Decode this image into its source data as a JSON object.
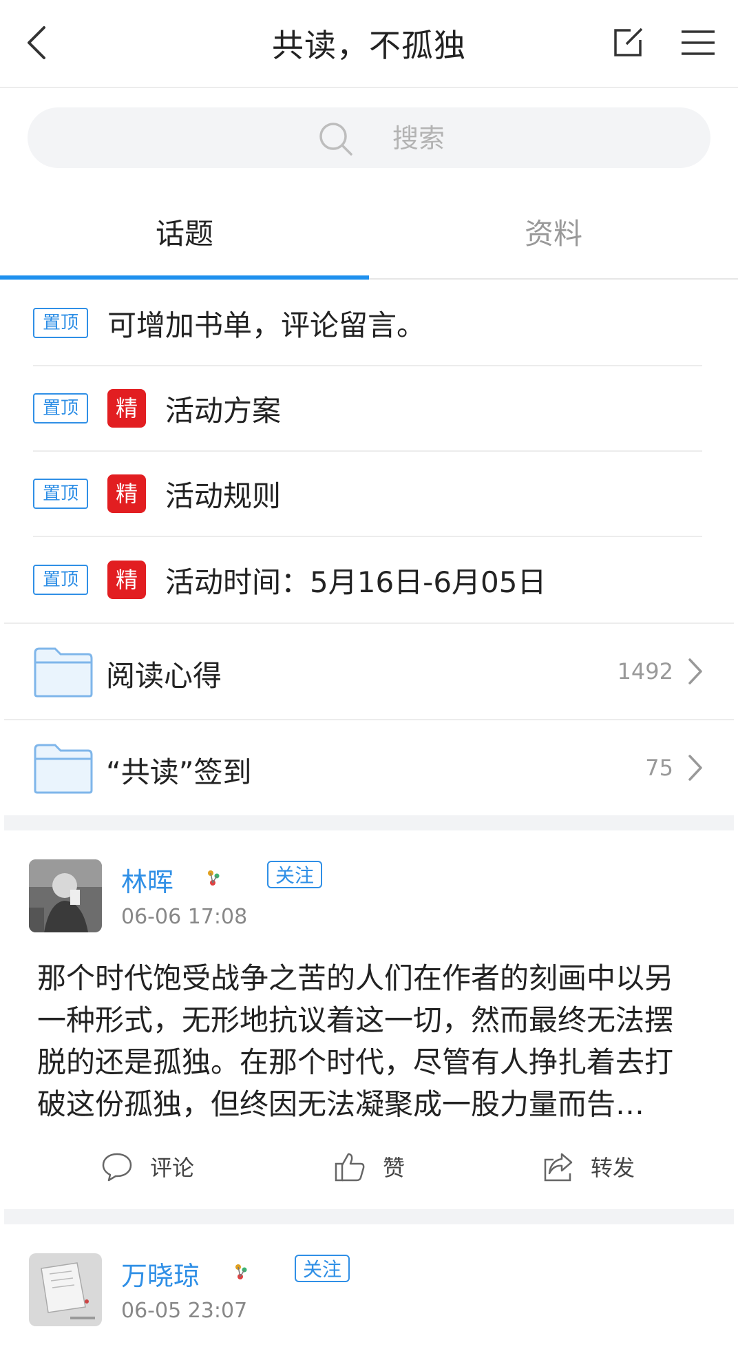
{
  "header": {
    "title": "共读，不孤独"
  },
  "search": {
    "placeholder": "搜索"
  },
  "tabs": [
    {
      "label": "话题",
      "active": true
    },
    {
      "label": "资料",
      "active": false
    }
  ],
  "pinned": [
    {
      "tag": "置顶",
      "essence": null,
      "text": "可增加书单，评论留言。"
    },
    {
      "tag": "置顶",
      "essence": "精",
      "text": "活动方案"
    },
    {
      "tag": "置顶",
      "essence": "精",
      "text": "活动规则"
    },
    {
      "tag": "置顶",
      "essence": "精",
      "text": "活动时间：5月16日-6月05日"
    }
  ],
  "folders": [
    {
      "name": "阅读心得",
      "count": "1492"
    },
    {
      "name": "“共读”签到",
      "count": "75"
    }
  ],
  "posts": [
    {
      "author": "林晖",
      "follow_label": "关注",
      "time": "06-06 17:08",
      "body": "那个时代饱受战争之苦的人们在作者的刻画中以另一种形式，无形地抗议着这一切，然而最终无法摆脱的还是孤独。在那个时代，尽管有人挣扎着去打破这份孤独，但终因无法凝聚成一股力量而告…",
      "actions": {
        "comment": "评论",
        "like": "赞",
        "share": "转发"
      }
    },
    {
      "author": "万晓琼",
      "follow_label": "关注",
      "time": "06-05 23:07"
    }
  ],
  "colors": {
    "accent": "#2f8fe6",
    "essence_red": "#e21e21",
    "tab_indicator": "#1e90ee"
  }
}
